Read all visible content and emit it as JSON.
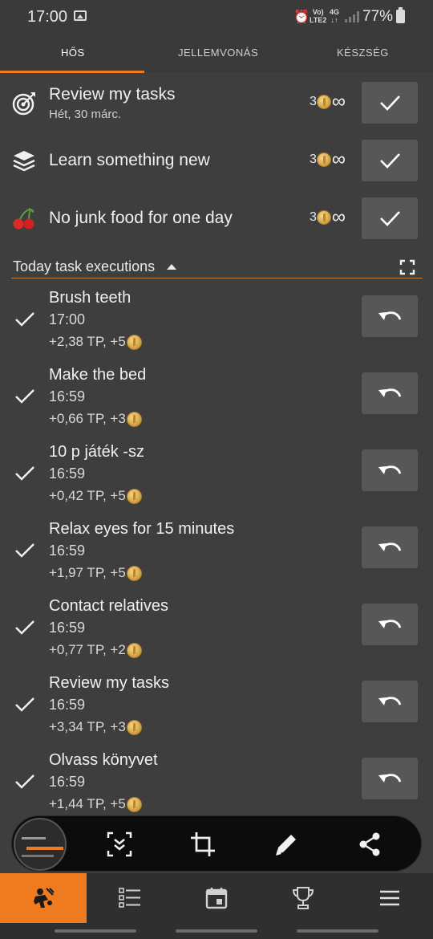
{
  "status_bar": {
    "time": "17:00",
    "volte": "Vo)\nLTE2",
    "network": "4G\n↓↑",
    "battery_percent": "77%",
    "battery_level": 0.77
  },
  "tabs": [
    {
      "label": "HŐS",
      "active": true
    },
    {
      "label": "JELLEMVONÁS",
      "active": false
    },
    {
      "label": "KÉSZSÉG",
      "active": false
    }
  ],
  "dailies": [
    {
      "title": "Review my tasks",
      "subtitle": "Hét, 30 márc.",
      "reward": "3",
      "icon": "target-icon"
    },
    {
      "title": "Learn something new",
      "subtitle": "",
      "reward": "3",
      "icon": "books-icon"
    },
    {
      "title": "No junk food for one day",
      "subtitle": "",
      "reward": "3",
      "icon": "cherries-icon"
    }
  ],
  "section": {
    "title": "Today task executions"
  },
  "executions": [
    {
      "title": "Brush teeth",
      "time": "17:00",
      "reward": "+2,38 TP, +5"
    },
    {
      "title": "Make the bed",
      "time": "16:59",
      "reward": "+0,66 TP, +3"
    },
    {
      "title": "10 p játék -sz",
      "time": "16:59",
      "reward": "+0,42 TP, +5"
    },
    {
      "title": "Relax eyes for 15 minutes",
      "time": "16:59",
      "reward": "+1,97 TP, +5"
    },
    {
      "title": "Contact relatives",
      "time": "16:59",
      "reward": "+0,77 TP, +2"
    },
    {
      "title": "Review my tasks",
      "time": "16:59",
      "reward": "+3,34 TP, +3"
    },
    {
      "title": "Olvass könyvet",
      "time": "16:59",
      "reward": "+1,44 TP, +5"
    }
  ],
  "capture_toolbar": {
    "icons": [
      "scroll-capture-icon",
      "crop-icon",
      "pencil-icon",
      "share-icon"
    ]
  },
  "bottom_nav": {
    "items": [
      "hero-icon",
      "task-list-icon",
      "calendar-icon",
      "trophy-icon",
      "menu-icon"
    ],
    "active_index": 0
  },
  "colors": {
    "accent": "#f07a1e",
    "background": "#3e3e3e",
    "button": "#575757"
  }
}
